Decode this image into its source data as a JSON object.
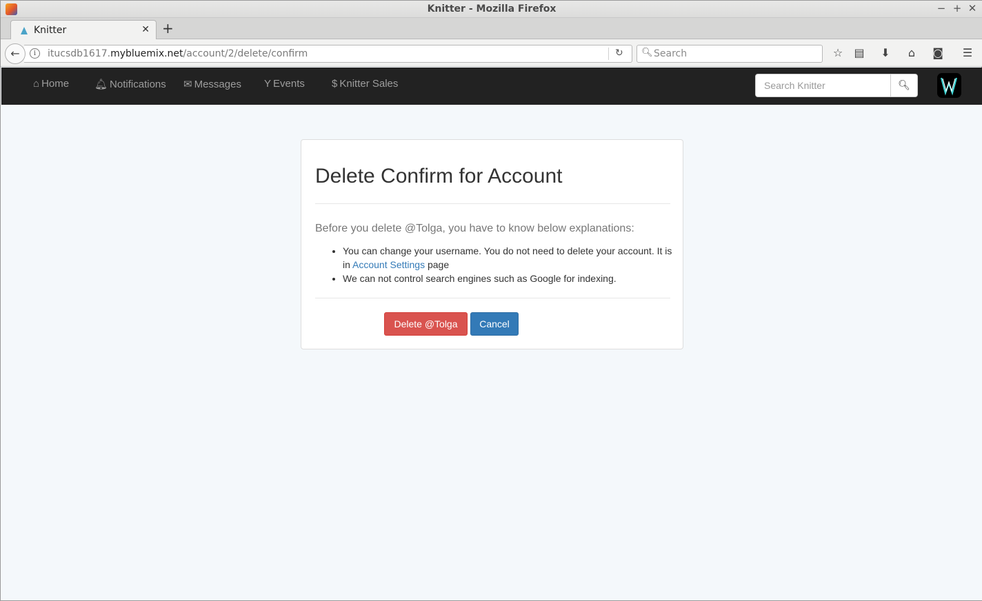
{
  "window": {
    "title": "Knitter - Mozilla Firefox"
  },
  "browser": {
    "tab_title": "Knitter",
    "url_prefix": "itucsdb1617.",
    "url_host": "mybluemix.net",
    "url_path": "/account/2/delete/confirm",
    "search_placeholder": "Search"
  },
  "site_nav": {
    "items": [
      {
        "icon": "home-icon",
        "label": "Home"
      },
      {
        "icon": "bell-icon",
        "label": "Notifications"
      },
      {
        "icon": "envelope-icon",
        "label": "Messages"
      },
      {
        "icon": "filter-icon",
        "label": "Events"
      },
      {
        "icon": "dollar-icon",
        "label": "Knitter Sales"
      }
    ],
    "search_placeholder": "Search Knitter"
  },
  "panel": {
    "heading": "Delete Confirm for Account",
    "lead": "Before you delete @Tolga, you have to know below explanations:",
    "bullet1_text": "You can change your username. You do not need to delete your account. It is in ",
    "bullet1_link": "Account Settings",
    "bullet1_suffix": " page",
    "bullet2_text": "We can not control search engines such as Google for indexing.",
    "delete_button": "Delete @Tolga",
    "cancel_button": "Cancel"
  },
  "colors": {
    "navbar": "#222222",
    "danger": "#d9534f",
    "primary": "#337ab7",
    "link": "#337ab7"
  }
}
